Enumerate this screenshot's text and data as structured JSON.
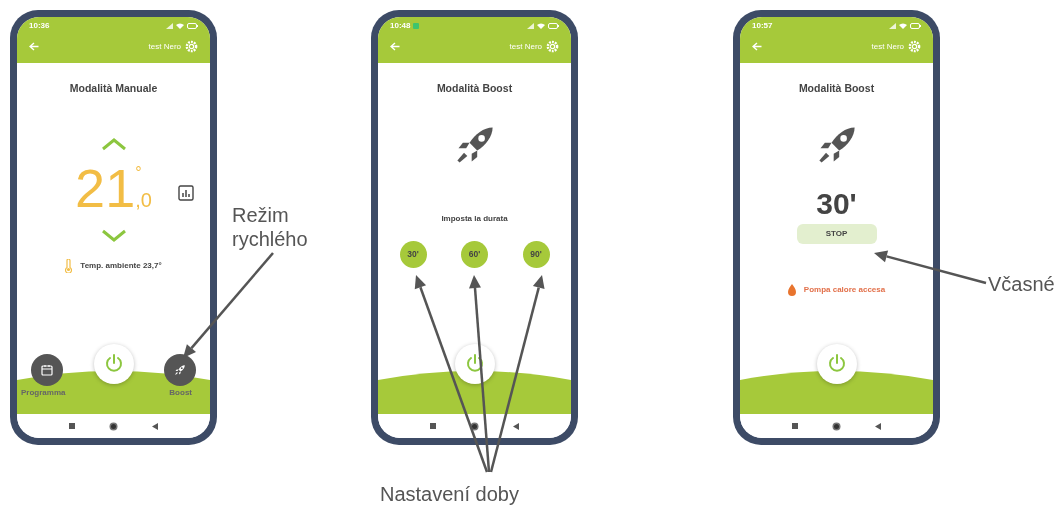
{
  "phones": [
    {
      "kind": "manual",
      "status_time": "10:36",
      "notification_icon": false,
      "header_name": "test Nero",
      "title": "Modalità Manuale",
      "setpoint_integer": "21",
      "setpoint_decimal": ",0",
      "degree": "°",
      "ambient": "Temp. ambiente 23,7°",
      "left_button": "Programma",
      "right_button": "Boost"
    },
    {
      "kind": "boost_select",
      "status_time": "10:48",
      "notification_icon": true,
      "header_name": "test Nero",
      "title": "Modalità Boost",
      "prompt": "Imposta la durata",
      "durations": [
        "30'",
        "60'",
        "90'"
      ]
    },
    {
      "kind": "boost_running",
      "status_time": "10:57",
      "notification_icon": false,
      "header_name": "test Nero",
      "title": "Modalità Boost",
      "remaining": "30'",
      "stop_button": "STOP",
      "status_message": "Pompa calore accesa"
    }
  ],
  "annotations": [
    {
      "text": "Režim rychlého"
    },
    {
      "text": "Nastavení doby"
    },
    {
      "text": "Včasné"
    }
  ]
}
